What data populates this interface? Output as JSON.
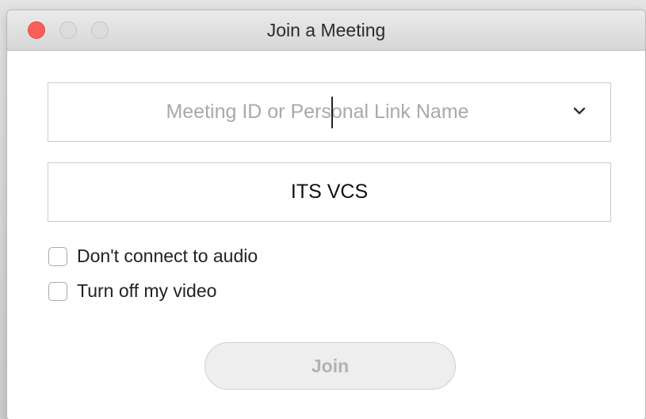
{
  "window": {
    "title": "Join a Meeting"
  },
  "meeting_id": {
    "placeholder": "Meeting ID or Personal Link Name",
    "value": ""
  },
  "display_name": {
    "value": "ITS VCS"
  },
  "options": [
    {
      "label": "Don't connect to audio",
      "checked": false
    },
    {
      "label": "Turn off my video",
      "checked": false
    }
  ],
  "join": {
    "label": "Join",
    "enabled": false
  },
  "colors": {
    "close_button": "#fc5f57",
    "placeholder_text": "#a9a9a9",
    "disabled_button_text": "#b2b2b2"
  },
  "icons": {
    "dropdown": "chevron-down-icon"
  }
}
